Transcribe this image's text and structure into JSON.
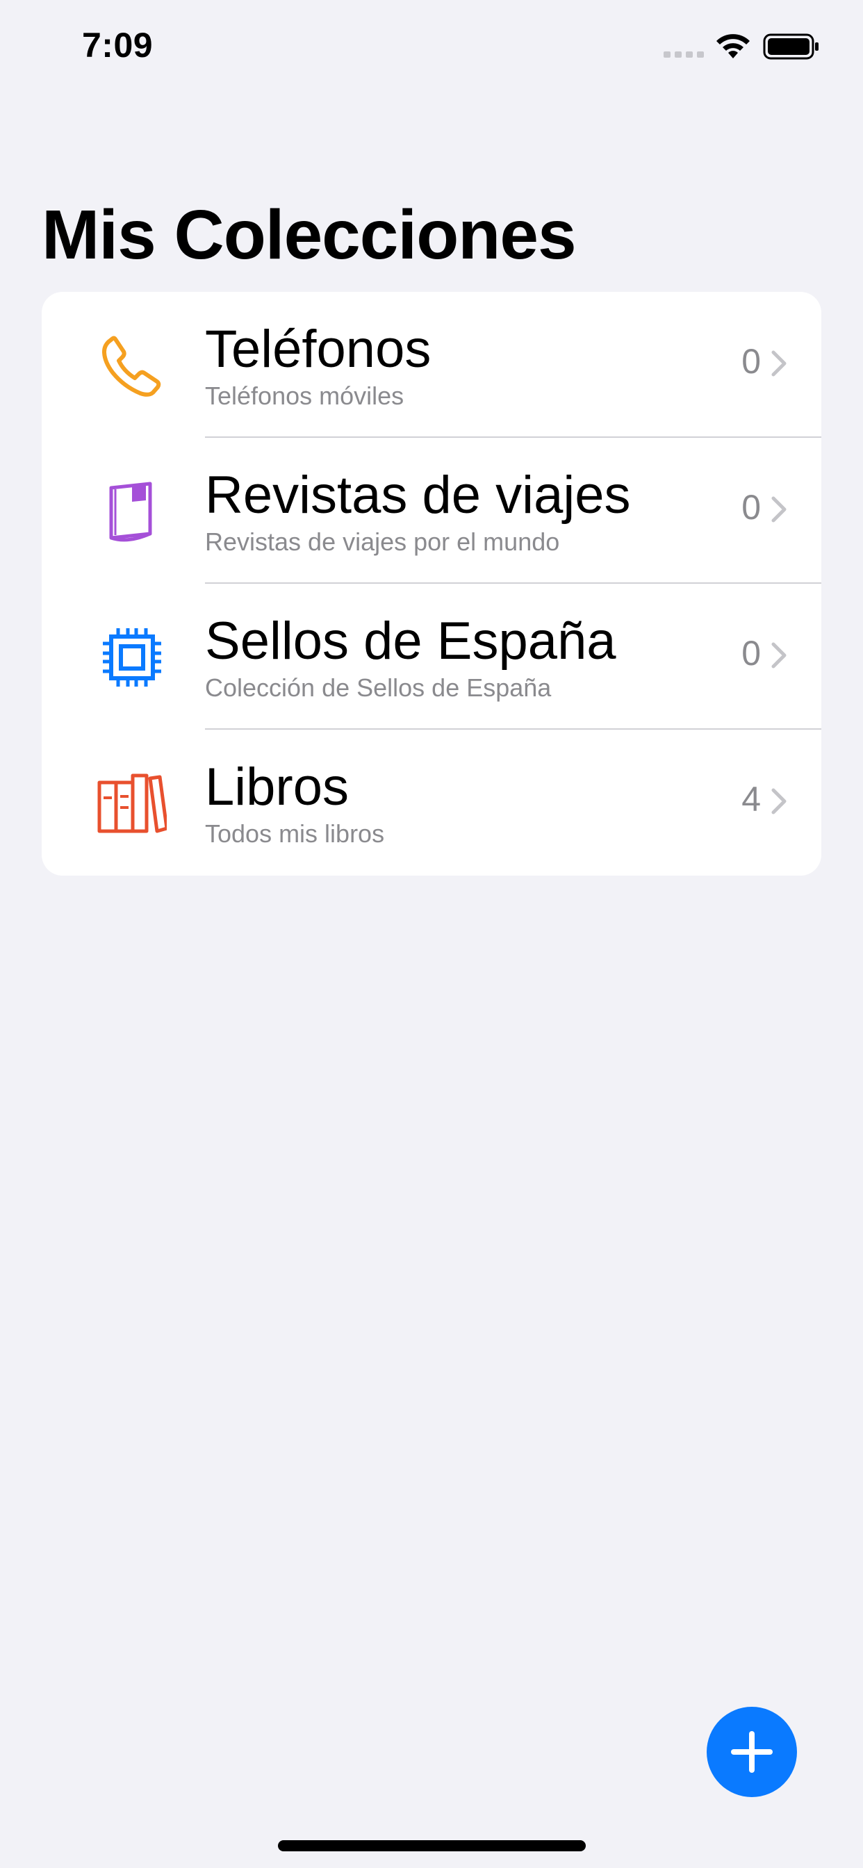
{
  "status_bar": {
    "time": "7:09",
    "icons": [
      "signal-icon",
      "wifi-icon",
      "battery-icon"
    ]
  },
  "header": {
    "title": "Mis Colecciones"
  },
  "collections": [
    {
      "icon": "phone-icon",
      "icon_color": "#f5a020",
      "title": "Teléfonos",
      "subtitle": "Teléfonos móviles",
      "count": "0"
    },
    {
      "icon": "magazine-icon",
      "icon_color": "#a550d8",
      "title": "Revistas de viajes",
      "subtitle": "Revistas de viajes por el mundo",
      "count": "0"
    },
    {
      "icon": "stamp-chip-icon",
      "icon_color": "#0a7aff",
      "title": "Sellos de España",
      "subtitle": "Colección de Sellos de España",
      "count": "0"
    },
    {
      "icon": "books-icon",
      "icon_color": "#e8502e",
      "title": "Libros",
      "subtitle": "Todos mis libros",
      "count": "4"
    }
  ],
  "fab": {
    "icon": "plus-icon",
    "color": "#0a7aff"
  }
}
